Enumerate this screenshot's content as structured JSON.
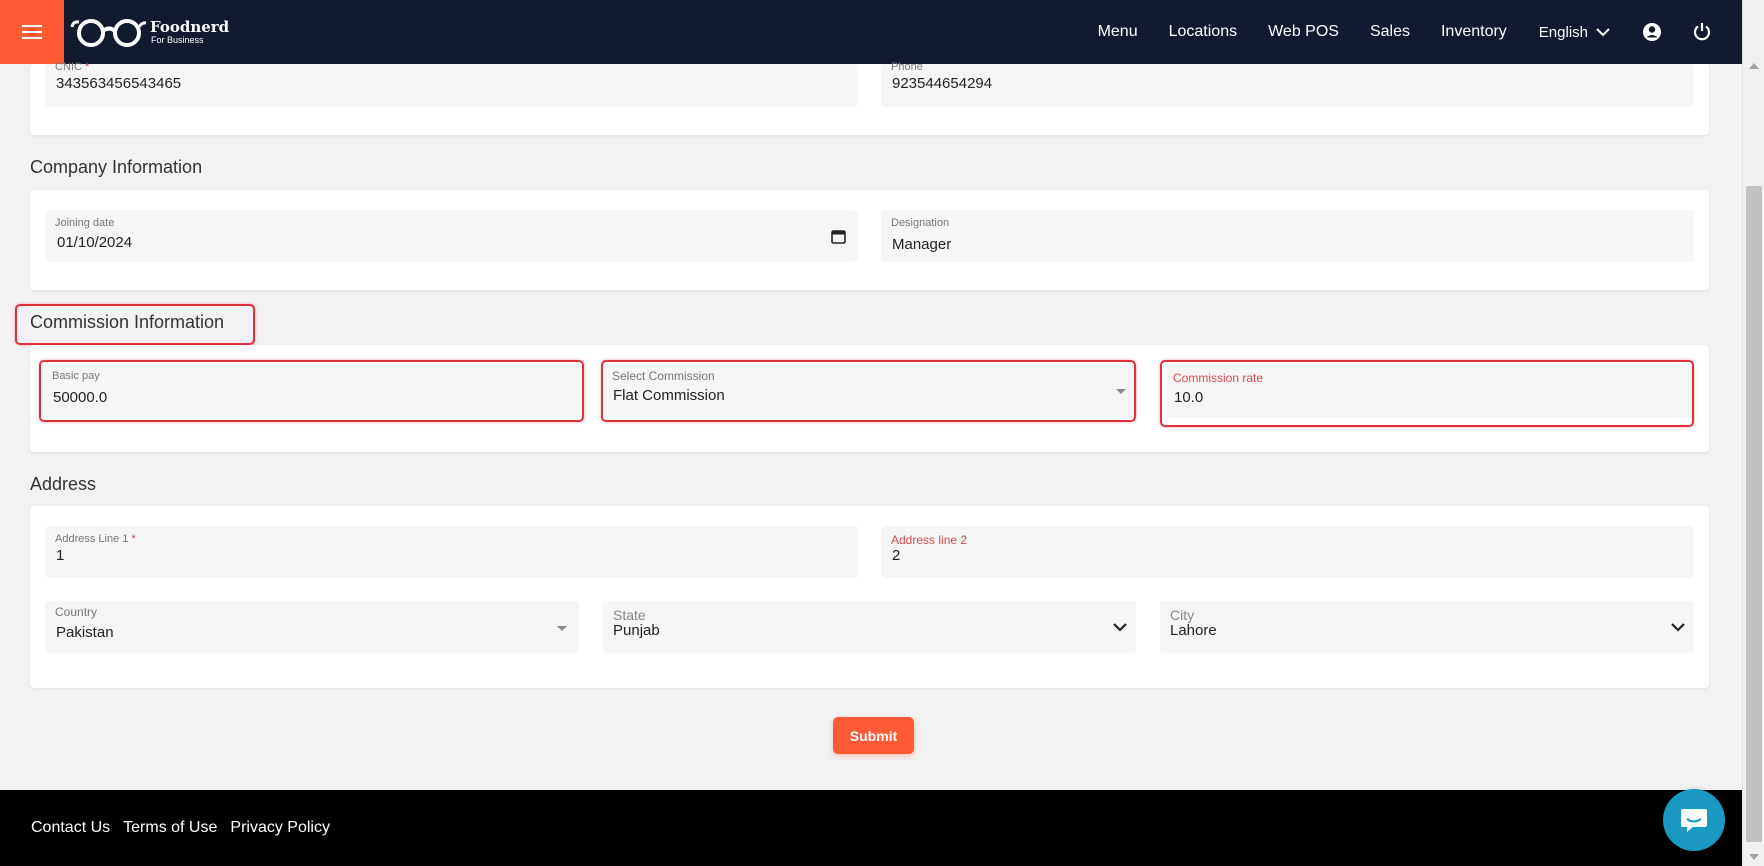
{
  "header": {
    "logo_title": "Foodnerd",
    "logo_subtitle": "For Business",
    "nav": [
      "Menu",
      "Locations",
      "Web POS",
      "Sales",
      "Inventory"
    ],
    "language": "English",
    "icons": [
      "hamburger-icon",
      "glasses-logo-icon",
      "chevron-down-icon",
      "account-circle-icon",
      "power-icon"
    ]
  },
  "personal": {
    "cnic_label": "CNIC",
    "cnic_required": "*",
    "cnic_value": "343563456543465",
    "phone_label": "Phone",
    "phone_value": "923544654294"
  },
  "company": {
    "title": "Company Information",
    "joining_label": "Joining date",
    "joining_value": "01/10/2024",
    "designation_label": "Designation",
    "designation_value": "Manager"
  },
  "commission": {
    "title": "Commission Information",
    "basic_pay_label": "Basic pay",
    "basic_pay_value": "50000.0",
    "select_label": "Select Commission",
    "select_value": "Flat Commission",
    "rate_label": "Commission rate",
    "rate_value": "10.0"
  },
  "address": {
    "title": "Address",
    "line1_label": "Address Line 1",
    "line1_required": "*",
    "line1_value": "1",
    "line2_label": "Address line 2",
    "line2_value": "2",
    "country_label": "Country",
    "country_value": "Pakistan",
    "state_label": "State",
    "state_value": "Punjab",
    "city_label": "City",
    "city_value": "Lahore"
  },
  "submit_label": "Submit",
  "footer": {
    "links": [
      "Contact Us",
      "Terms of Use",
      "Privacy Policy"
    ]
  },
  "colors": {
    "topbar": "#121a2f",
    "accent": "#ff5a36",
    "highlight": "#e0303a",
    "chat": "#1a9ac2"
  }
}
